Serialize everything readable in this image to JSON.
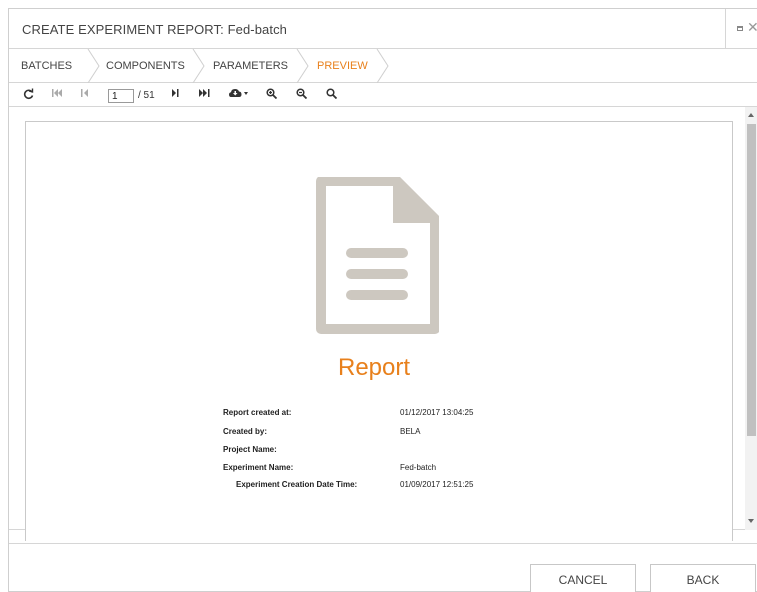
{
  "dialog": {
    "title": "CREATE EXPERIMENT REPORT: Fed-batch",
    "controls": {
      "restore_icon": "restore-icon",
      "close_glyph": "✕"
    }
  },
  "wizard": {
    "steps": [
      {
        "label": "BATCHES",
        "active": false
      },
      {
        "label": "COMPONENTS",
        "active": false
      },
      {
        "label": "PARAMETERS",
        "active": false
      },
      {
        "label": "PREVIEW",
        "active": true
      }
    ],
    "active_color": "#e8801c"
  },
  "toolbar": {
    "icons": [
      "refresh-icon",
      "first-page-icon",
      "previous-page-icon",
      "next-page-icon",
      "last-page-icon",
      "export-icon",
      "zoom-in-icon",
      "zoom-out-icon",
      "search-icon"
    ],
    "current_page": "1",
    "total_pages": "/ 51"
  },
  "report": {
    "icon": "document-icon",
    "title": "Report",
    "fields": [
      {
        "label": "Report created at:",
        "value": "01/12/2017 13:04:25"
      },
      {
        "label": "Created by:",
        "value": "BELA"
      },
      {
        "label": "Project Name:",
        "value": ""
      },
      {
        "label": "Experiment Name:",
        "value": "Fed-batch"
      },
      {
        "label": "Experiment Creation Date Time:",
        "value": "01/09/2017 12:51:25"
      }
    ]
  },
  "footer": {
    "cancel_label": "CANCEL",
    "back_label": "BACK"
  },
  "colors": {
    "accent": "#e8801c",
    "doc_icon": "#cdc8c0",
    "border": "#d6d6d6"
  }
}
